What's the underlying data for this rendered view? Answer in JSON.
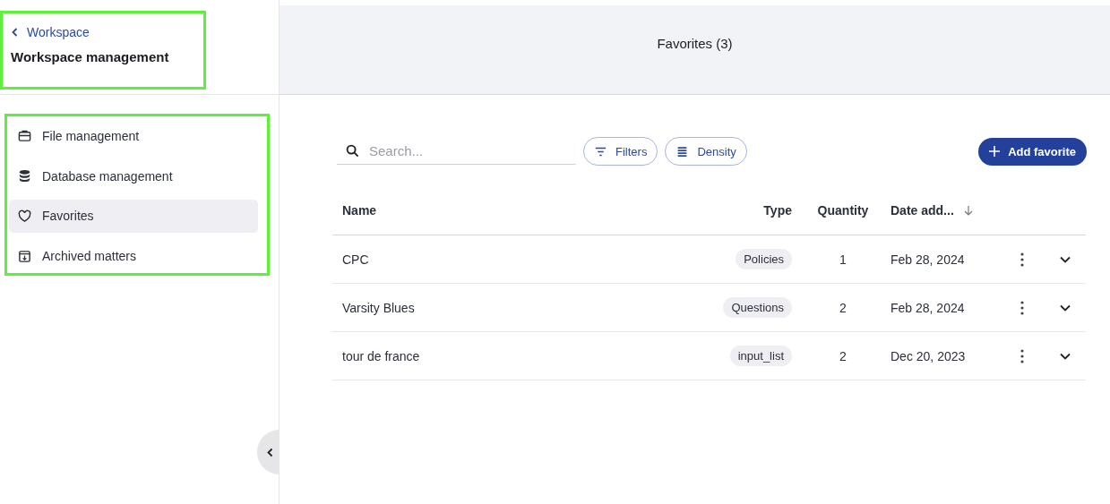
{
  "sidebar": {
    "back_link": "Workspace",
    "title": "Workspace management",
    "items": [
      {
        "label": "File management",
        "selected": false
      },
      {
        "label": "Database management",
        "selected": false
      },
      {
        "label": "Favorites",
        "selected": true
      },
      {
        "label": "Archived matters",
        "selected": false
      }
    ]
  },
  "header": {
    "title": "Favorites (3)"
  },
  "toolbar": {
    "search": {
      "placeholder": "Search..."
    },
    "buttons": [
      "Filters",
      "Density"
    ],
    "add_button": "Add favorite"
  },
  "table": {
    "columns": [
      {
        "label": "Name",
        "sorted": false
      },
      {
        "label": "Type",
        "sorted": false
      },
      {
        "label": "Quantity",
        "sorted": false
      },
      {
        "label": "Date add...",
        "sorted": true
      }
    ],
    "rows": [
      {
        "name": "CPC",
        "type": "Policies",
        "quantity": "1",
        "date": "Feb 28, 2024"
      },
      {
        "name": "Varsity Blues",
        "type": "Questions",
        "quantity": "2",
        "date": "Feb 28, 2024"
      },
      {
        "name": "tour de france",
        "type": "input_list",
        "quantity": "2",
        "date": "Dec 20, 2023"
      }
    ]
  }
}
